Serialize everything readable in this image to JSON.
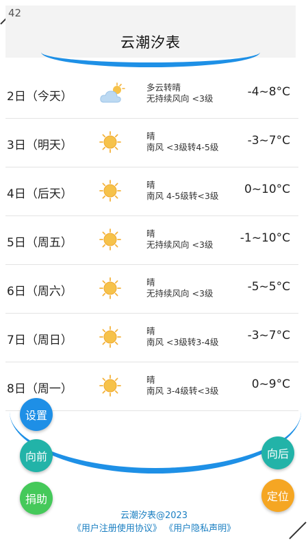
{
  "header": {
    "number": "42",
    "title": "云潮汐表"
  },
  "forecast": [
    {
      "date": "2日（今天）",
      "icon": "partly-cloudy-icon",
      "weather": "多云转晴",
      "wind": "无持续风向 <3级",
      "temp": "-4~8°C"
    },
    {
      "date": "3日（明天）",
      "icon": "sunny-icon",
      "weather": "晴",
      "wind": "南风 <3级转4-5级",
      "temp": "-3~7°C"
    },
    {
      "date": "4日（后天）",
      "icon": "sunny-icon",
      "weather": "晴",
      "wind": "南风 4-5级转<3级",
      "temp": "0~10°C"
    },
    {
      "date": "5日（周五）",
      "icon": "sunny-icon",
      "weather": "晴",
      "wind": "无持续风向 <3级",
      "temp": "-1~10°C"
    },
    {
      "date": "6日（周六）",
      "icon": "sunny-icon",
      "weather": "晴",
      "wind": "无持续风向 <3级",
      "temp": "-5~5°C"
    },
    {
      "date": "7日（周日）",
      "icon": "sunny-icon",
      "weather": "晴",
      "wind": "南风 <3级转3-4级",
      "temp": "-3~7°C"
    },
    {
      "date": "8日（周一）",
      "icon": "sunny-icon",
      "weather": "晴",
      "wind": "南风 3-4级转<3级",
      "temp": "0~9°C"
    }
  ],
  "buttons": {
    "settings": "设置",
    "forward": "向前",
    "backward": "向后",
    "donate": "捐助",
    "locate": "定位"
  },
  "footer": {
    "brand": "云潮汐表@2023",
    "user_agreement": "《用户注册使用协议》",
    "privacy_policy": "《用户隐私声明》"
  },
  "colors": {
    "settings": "#1e8fe6",
    "forward": "#22b3a8",
    "backward": "#22b3a8",
    "donate": "#45c95a",
    "locate": "#f5a623",
    "arc": "#1e90e6"
  }
}
